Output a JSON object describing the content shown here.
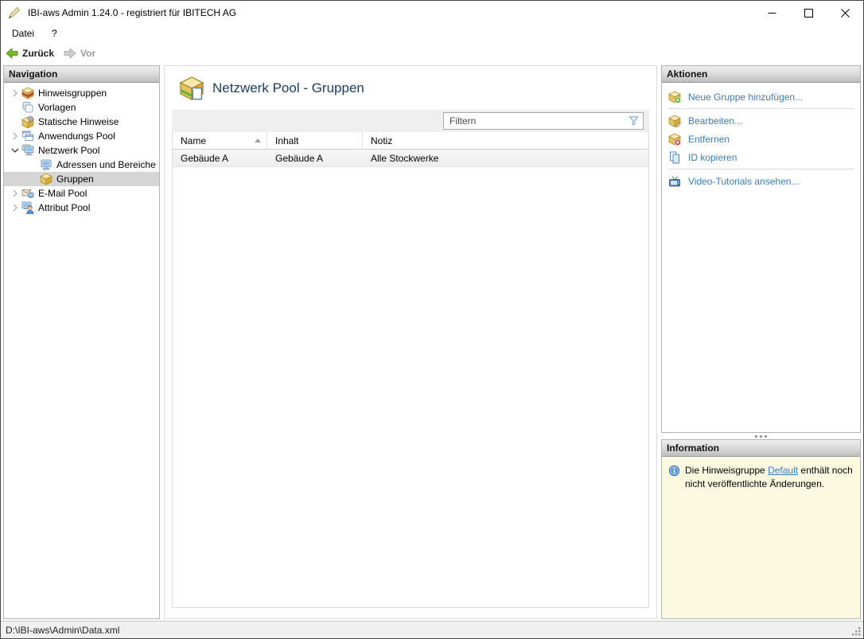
{
  "window": {
    "title": "IBI-aws Admin 1.24.0 - registriert für IBITECH AG"
  },
  "menu": {
    "items": [
      {
        "label": "Datei"
      },
      {
        "label": "?"
      }
    ]
  },
  "toolbar": {
    "back_label": "Zurück",
    "forward_label": "Vor"
  },
  "navigation": {
    "header": "Navigation",
    "items": [
      {
        "label": "Hinweisgruppen"
      },
      {
        "label": "Vorlagen"
      },
      {
        "label": "Statische Hinweise"
      },
      {
        "label": "Anwendungs Pool"
      },
      {
        "label": "Netzwerk Pool"
      },
      {
        "label": "Adressen und Bereiche"
      },
      {
        "label": "Gruppen"
      },
      {
        "label": "E-Mail Pool"
      },
      {
        "label": "Attribut Pool"
      }
    ]
  },
  "main": {
    "title": "Netzwerk Pool - Gruppen",
    "filter_placeholder": "Filtern",
    "table": {
      "columns": [
        "Name",
        "Inhalt",
        "Notiz"
      ],
      "rows": [
        [
          "Gebäude A",
          "Gebäude A",
          "Alle Stockwerke"
        ]
      ]
    }
  },
  "actions": {
    "header": "Aktionen",
    "items": [
      {
        "label": "Neue Gruppe hinzufügen..."
      },
      {
        "label": "Bearbeiten..."
      },
      {
        "label": "Entfernen"
      },
      {
        "label": "ID kopieren"
      },
      {
        "label": "Video-Tutorials ansehen..."
      }
    ]
  },
  "information": {
    "header": "Information",
    "text_before": "Die Hinweisgruppe ",
    "link": "Default",
    "text_after": " enthält noch nicht veröffentlichte Änderungen."
  },
  "statusbar": {
    "path": "D:\\IBI-aws\\Admin\\Data.xml"
  },
  "colors": {
    "link_blue": "#3b7dbd",
    "title_navy": "#1d3a5f",
    "info_yellow": "#fbfae1",
    "selected_gray": "#d5d5d5",
    "back_arrow_green": "#76b82a"
  }
}
